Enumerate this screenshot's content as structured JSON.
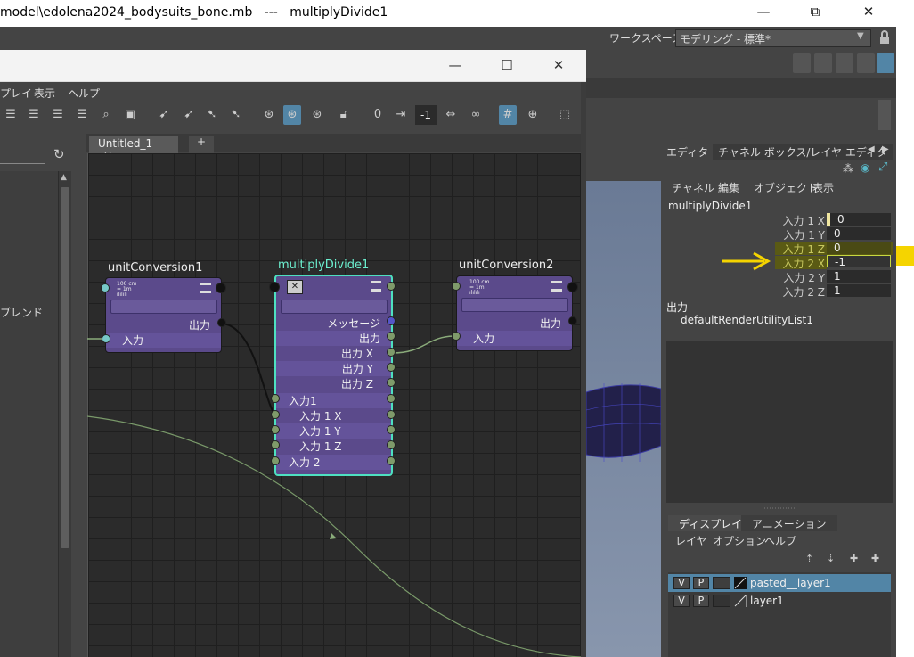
{
  "window": {
    "title": "model\\edolena2024_bodysuits_bone.mb   ---   multiplyDivide1",
    "minimize": "—",
    "maximize": "⧉",
    "close": "✕"
  },
  "maya": {
    "workspace_label": "ワークスペース:",
    "workspace_value": "モデリング - 標準*"
  },
  "node_editor": {
    "menu": [
      "プレイ",
      "表示",
      "ヘルプ"
    ],
    "toolbar_value": "-1",
    "tab_label": "Untitled_1",
    "tab_add": "+",
    "left_item": "ブレンド",
    "nodes": {
      "unitConversion1": {
        "title": "unitConversion1",
        "icon_text": "100 cm\n= 1m\nılılılı",
        "output": "出力",
        "input": "入力"
      },
      "multiplyDivide1": {
        "title": "multiplyDivide1",
        "message": "メッセージ",
        "output": "出力",
        "output_x": "出力 X",
        "output_y": "出力 Y",
        "output_z": "出力 Z",
        "input1": "入力1",
        "input1_x": "入力 1 X",
        "input1_y": "入力 1 Y",
        "input1_z": "入力 1 Z",
        "input2": "入力 2"
      },
      "unitConversion2": {
        "title": "unitConversion2",
        "icon_text": "100 cm\n= 1m\nılılılı",
        "output": "出力",
        "input": "入力"
      }
    }
  },
  "channel_box": {
    "tabs": [
      "エディタ",
      "チャネル ボックス/レイヤ エディタ"
    ],
    "menu": [
      "チャネル",
      "編集",
      "オブジェクト",
      "表示"
    ],
    "node_name": "multiplyDivide1",
    "attributes": [
      {
        "label": "入力 1 X",
        "value": "0"
      },
      {
        "label": "入力 1 Y",
        "value": "0"
      },
      {
        "label": "入力 1 Z",
        "value": "0"
      },
      {
        "label": "入力 2 X",
        "value": "-1"
      },
      {
        "label": "入力 2 Y",
        "value": "1"
      },
      {
        "label": "入力 2 Z",
        "value": "1"
      }
    ],
    "outputs_label": "出力",
    "output_item": "defaultRenderUtilityList1"
  },
  "layer_editor": {
    "tabs": [
      "ディスプレイ",
      "アニメーション"
    ],
    "menu": [
      "レイヤ",
      "オプション",
      "ヘルプ"
    ],
    "layers": [
      {
        "v": "V",
        "p": "P",
        "name": "pasted__layer1",
        "selected": true
      },
      {
        "v": "V",
        "p": "P",
        "name": "layer1",
        "selected": false
      }
    ]
  },
  "colors": {
    "node_purple": "#5b4a8b",
    "selected_outline": "#4ee0c0",
    "selection_blue": "#5285a6",
    "annotation_yellow": "#f5d400"
  }
}
